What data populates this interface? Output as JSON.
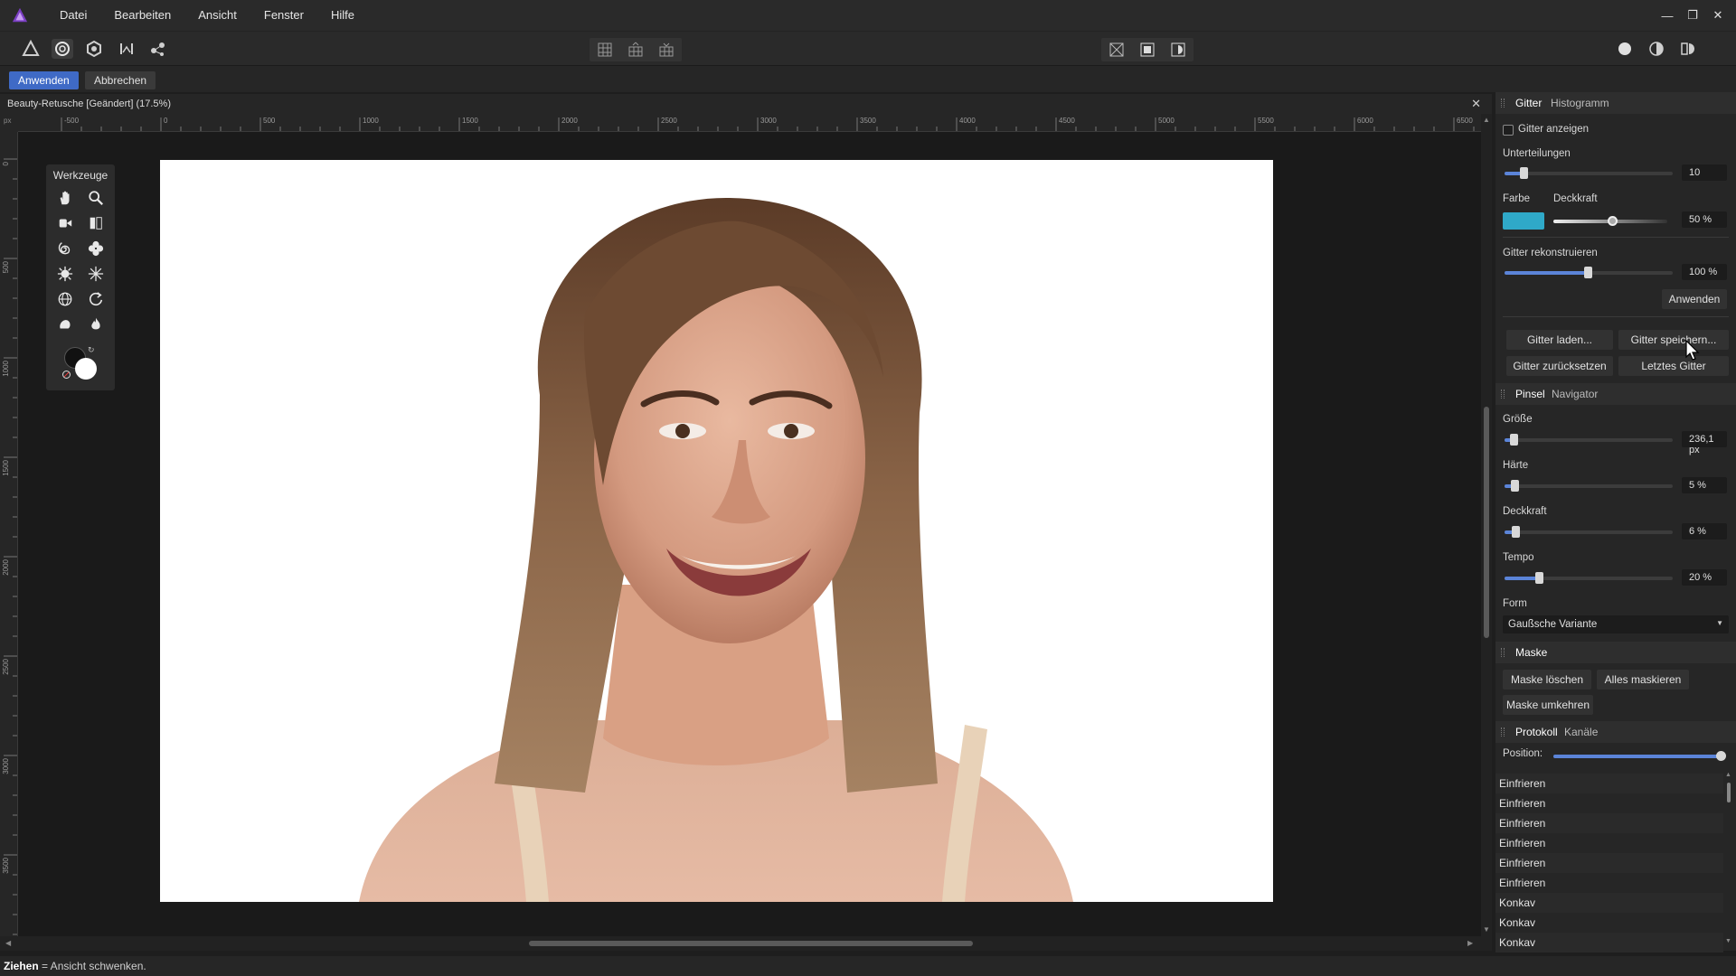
{
  "menu": {
    "items": [
      "Datei",
      "Bearbeiten",
      "Ansicht",
      "Fenster",
      "Hilfe"
    ]
  },
  "context": {
    "apply_label": "Anwenden",
    "cancel_label": "Abbrechen"
  },
  "document": {
    "title": "Beauty-Retusche [Geändert] (17.5%)"
  },
  "ruler": {
    "unit": "px",
    "h_ticks": [
      "-500",
      "0",
      "500",
      "1000",
      "1500",
      "2000",
      "2500",
      "3000",
      "3500",
      "4000",
      "4500",
      "5000",
      "5500",
      "6000",
      "6500"
    ],
    "v_ticks": [
      "0",
      "500",
      "1000",
      "1500",
      "2000",
      "2500",
      "3000",
      "3500"
    ]
  },
  "tools_panel": {
    "title": "Werkzeuge"
  },
  "grid_panel": {
    "tabs": [
      "Gitter",
      "Histogramm"
    ],
    "show_grid_label": "Gitter anzeigen",
    "subdivisions_label": "Unterteilungen",
    "subdivisions_value": "10",
    "color_label": "Farbe",
    "opacity_label": "Deckkraft",
    "opacity_value": "50 %",
    "swatch_color": "#2fa9c8",
    "rebuild_label": "Gitter rekonstruieren",
    "rebuild_value": "100 %",
    "apply_label": "Anwenden",
    "load_label": "Gitter laden...",
    "save_label": "Gitter speichern...",
    "reset_label": "Gitter zurücksetzen",
    "last_label": "Letztes Gitter"
  },
  "brush_panel": {
    "tabs": [
      "Pinsel",
      "Navigator"
    ],
    "size_label": "Größe",
    "size_value": "236,1 px",
    "hardness_label": "Härte",
    "hardness_value": "5 %",
    "opacity_label": "Deckkraft",
    "opacity_value": "6 %",
    "speed_label": "Tempo",
    "speed_value": "20 %",
    "shape_label": "Form",
    "shape_value": "Gaußsche Variante"
  },
  "mask_panel": {
    "title": "Maske",
    "clear_label": "Maske löschen",
    "all_label": "Alles maskieren",
    "invert_label": "Maske umkehren"
  },
  "history_panel": {
    "tabs": [
      "Protokoll",
      "Kanäle"
    ],
    "position_label": "Position:",
    "items": [
      "Einfrieren",
      "Einfrieren",
      "Einfrieren",
      "Einfrieren",
      "Einfrieren",
      "Einfrieren",
      "Konkav",
      "Konkav",
      "Konkav"
    ]
  },
  "status": {
    "action": "Ziehen",
    "description": " = Ansicht schwenken."
  },
  "colors": {
    "accent": "#3f6ac6",
    "slider": "#5b84d8"
  }
}
